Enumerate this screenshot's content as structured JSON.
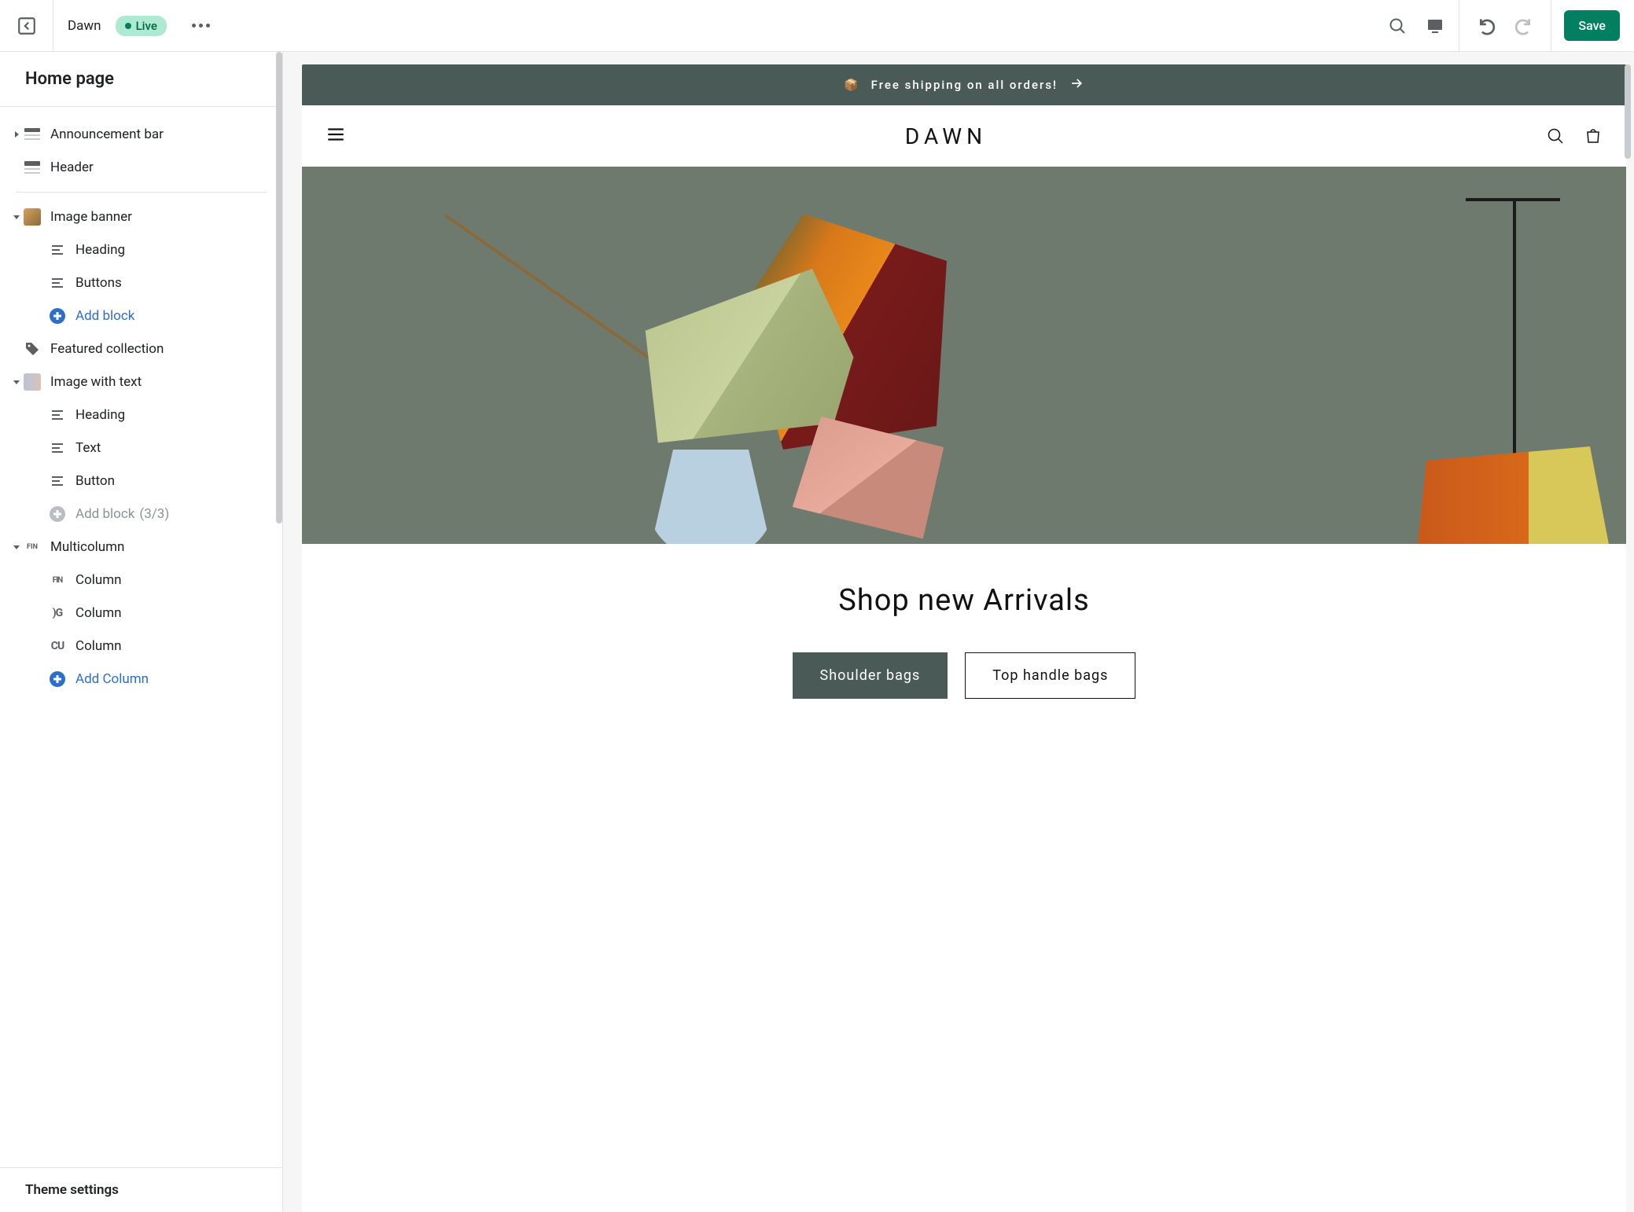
{
  "topbar": {
    "theme_name": "Dawn",
    "status_label": "Live",
    "save_label": "Save"
  },
  "sidebar": {
    "page_title": "Home page",
    "sections": {
      "announcement_bar": "Announcement bar",
      "header": "Header",
      "image_banner": {
        "label": "Image banner",
        "blocks": {
          "heading": "Heading",
          "buttons": "Buttons"
        },
        "add_block": "Add block"
      },
      "featured_collection": "Featured collection",
      "image_with_text": {
        "label": "Image with text",
        "blocks": {
          "heading": "Heading",
          "text": "Text",
          "button": "Button"
        },
        "add_block": "Add block",
        "add_block_count": "(3/3)"
      },
      "multicolumn": {
        "label": "Multicolumn",
        "columns": [
          "Column",
          "Column",
          "Column"
        ],
        "add_column": "Add Column"
      }
    },
    "theme_settings": "Theme settings"
  },
  "preview": {
    "announcement": {
      "icon": "📦",
      "text": "Free shipping on all orders!"
    },
    "store_name": "DAWN",
    "banner": {
      "heading": "Shop new Arrivals",
      "button_primary": "Shoulder bags",
      "button_secondary": "Top handle bags"
    }
  },
  "colors": {
    "accent": "#008060",
    "link": "#2c6ecb",
    "announce_bg": "#4a5b57"
  }
}
